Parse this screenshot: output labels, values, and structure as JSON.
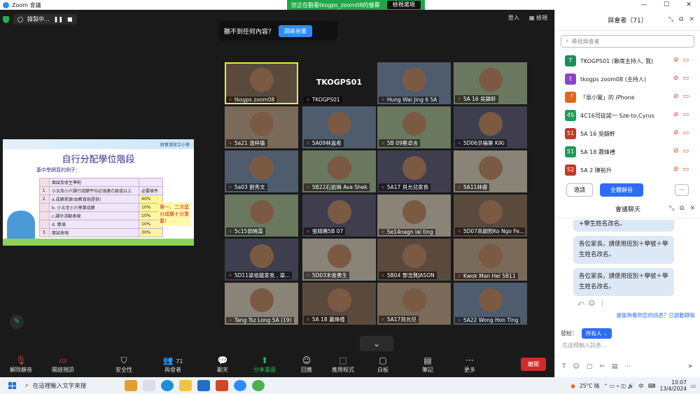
{
  "titlebar": {
    "app_title": "Zoom 會議",
    "viewing_text": "您正在觀看tkogps_zoom08的螢幕",
    "view_options": "檢視選項"
  },
  "window_controls": [
    "—",
    "☐",
    "✕"
  ],
  "recording": {
    "label": "錄製中..."
  },
  "stage_top": {
    "signin": "登入",
    "view": "檢視"
  },
  "hear_prompt": {
    "text": "聽不到任何內容？",
    "button": "調高音量"
  },
  "slide": {
    "school": "將軍澳官立小學",
    "title": "自行分配學位階段",
    "subtitle": "基中學網頁的例子：",
    "rows": [
      {
        "no": "",
        "item": "面試及收生準則",
        "pct": ""
      },
      {
        "no": "1.",
        "item": "小五及小六操行成績平均必須達乙級或以上",
        "pct": "必要條件"
      },
      {
        "no": "2.",
        "item": "a.成績來源(由教育局提供)",
        "pct": "40%"
      },
      {
        "no": "",
        "item": "b. 小五至小六學業成績",
        "pct": "10%"
      },
      {
        "no": "",
        "item": "c.課外活動表現",
        "pct": "10%"
      },
      {
        "no": "",
        "item": "d. 獎項",
        "pct": "10%"
      },
      {
        "no": "3.",
        "item": "面試表現",
        "pct": "30%"
      }
    ],
    "note": "第一、二次呈分成績十分重要!"
  },
  "gallery": [
    [
      "tkogps zoom08",
      "TKOGPS01",
      "Hung Wai Jing 6 5A",
      "5A 16 吳鑄軒"
    ],
    [
      "5a21 溫梓儀",
      "5A09林嘉希",
      "5B 09蔡卓言",
      "5D06洪楊樂 KiKi"
    ],
    [
      "5a03 劉秀文",
      "5B22石凱琳 Ava Shek",
      "5A17 貝允兒家長",
      "5A11林睿"
    ],
    [
      "5c15郭曉霖",
      "張晴晞5B 07",
      "5e14nagn lai ting",
      "5D07高穎熙Ko Ngo Fe..."
    ],
    [
      "5D11梁祖龍家長 , 梁...",
      "5D03禾俊勇生",
      "5B04 鄧浩賢JASON",
      "Kwok Man Hei 5B11"
    ],
    [
      "Tang Tsz Long 5A (19)",
      "5A 18 蕭烽禮",
      "5A17貝允兒",
      "5A22 Wong Hon Ting"
    ]
  ],
  "gallery_banner": "TKOGPS01",
  "toolbar": {
    "unmute": "解除靜音",
    "video": "開啟視訊",
    "security": "安全性",
    "participants": "與會者",
    "participant_count": "71",
    "chat": "聊天",
    "share": "分享畫面",
    "reactions": "回應",
    "apps": "應用程式",
    "whiteboard": "白板",
    "notes": "筆記",
    "more": "更多",
    "leave": "離開"
  },
  "participants_panel": {
    "title": "與會者（71）",
    "search_placeholder": "尋找與會者",
    "people": [
      {
        "initial": "T",
        "name": "TKOGPS01 (聯席主持人, 我)",
        "color": "#1e8c5a"
      },
      {
        "initial": "t",
        "name": "tkogps zoom08 (主持人)",
        "color": "#8e44c8"
      },
      {
        "initial": "「",
        "name": "「吳小鸞」的 iPhone",
        "color": "#e06a1c"
      },
      {
        "initial": "4S",
        "name": "4C16司徒諾一 Sze-to,Cyrus",
        "color": "#1e9c5a"
      },
      {
        "initial": "51",
        "name": "5A 16 吳鑄軒",
        "color": "#c0392b"
      },
      {
        "initial": "51",
        "name": "5A 18 蕭烽禮",
        "color": "#1e9c5a"
      },
      {
        "initial": "52",
        "name": "5A 2 陳裕升",
        "color": "#c0392b"
      }
    ],
    "invite": "邀請",
    "mute_all": "全體靜音",
    "more": "···"
  },
  "chat_panel": {
    "title": "會議聊天",
    "partial": "+學生姓名改名。",
    "messages": [
      "各位家長，請使用班別＋學號＋學生姓名改名。",
      "各位家長，請使用班別＋學號＋學生姓名改名。"
    ],
    "who_can_see": "誰能夠看到您的訊息？已啟動錄製",
    "send_to_label": "發給：",
    "send_to_value": "所有人",
    "input_placeholder": "在這裡輸入訊息..."
  },
  "taskbar": {
    "search_placeholder": "在這裡輸入文字來搜",
    "weather": "25°C 晴",
    "lang": "中",
    "time": "10:07",
    "date": "13/4/2024"
  },
  "colors": {
    "zoom_blue": "#2d8cff",
    "viewing_green": "#20a848",
    "leave_red": "#d02b2b",
    "mute_red": "#e63b3b"
  }
}
